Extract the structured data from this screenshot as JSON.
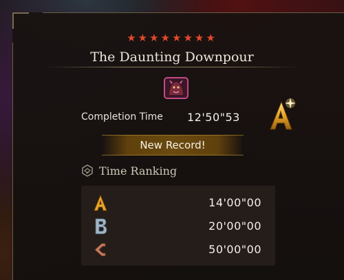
{
  "quest": {
    "stars": "★★★★★★★★",
    "title": "The Daunting Downpour",
    "monster_icon": "monster-portrait-icon"
  },
  "completion": {
    "label": "Completion Time",
    "value": "12'50\"53",
    "rank_letter": "A"
  },
  "banner": {
    "label": "New Record!"
  },
  "ranking": {
    "header": "Time Ranking",
    "rows": [
      {
        "letter": "A",
        "time": "14'00\"00"
      },
      {
        "letter": "B",
        "time": "20'00\"00"
      },
      {
        "letter": "C",
        "time": "50'00\"00"
      }
    ]
  },
  "colors": {
    "star": "#e24a2a",
    "rank_a": "#e8a526",
    "rank_b": "#9fb6c6",
    "rank_c": "#c87a5c",
    "banner": "#6a4a10"
  }
}
